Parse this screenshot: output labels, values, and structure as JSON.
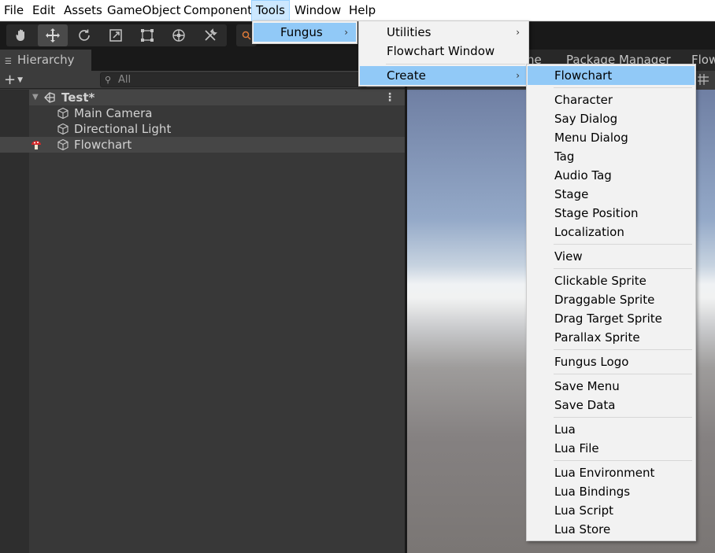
{
  "menubar": {
    "items": [
      {
        "label": "File"
      },
      {
        "label": "Edit"
      },
      {
        "label": "Assets"
      },
      {
        "label": "GameObject"
      },
      {
        "label": "Component"
      },
      {
        "label": "Tools"
      },
      {
        "label": "Window"
      },
      {
        "label": "Help"
      }
    ]
  },
  "toolbar": {
    "tools": [
      "hand-tool-icon",
      "move-tool-icon",
      "rotate-tool-icon",
      "scale-tool-icon",
      "rect-tool-icon",
      "transform-tool-icon",
      "custom-tools-icon"
    ],
    "active_tool": "move-tool-icon"
  },
  "hierarchy": {
    "tab_label": "Hierarchy",
    "search_placeholder": "All",
    "scene_name": "Test*",
    "objects": [
      {
        "label": "Main Camera"
      },
      {
        "label": "Directional Light"
      },
      {
        "label": "Flowchart"
      }
    ]
  },
  "scene_tabs": {
    "partial_tab": "ne",
    "package_manager": "Package Manager",
    "flow_partial": "Flow"
  },
  "menus": {
    "tools_menu": {
      "fungus_label": "Fungus"
    },
    "fungus_menu": {
      "utilities_label": "Utilities",
      "flowchart_window_label": "Flowchart Window",
      "create_label": "Create"
    },
    "create_menu": {
      "items": [
        "Flowchart",
        "Character",
        "Say Dialog",
        "Menu Dialog",
        "Tag",
        "Audio Tag",
        "Stage",
        "Stage Position",
        "Localization",
        "View",
        "Clickable Sprite",
        "Draggable Sprite",
        "Drag Target Sprite",
        "Parallax Sprite",
        "Fungus Logo",
        "Save Menu",
        "Save Data",
        "Lua",
        "Lua File",
        "Lua Environment",
        "Lua Bindings",
        "Lua Script",
        "Lua Store"
      ],
      "highlighted": "Flowchart"
    }
  },
  "colors": {
    "menu_highlight": "#91c9f7",
    "menubar_open": "#cce8ff",
    "editor_dark": "#383838"
  }
}
